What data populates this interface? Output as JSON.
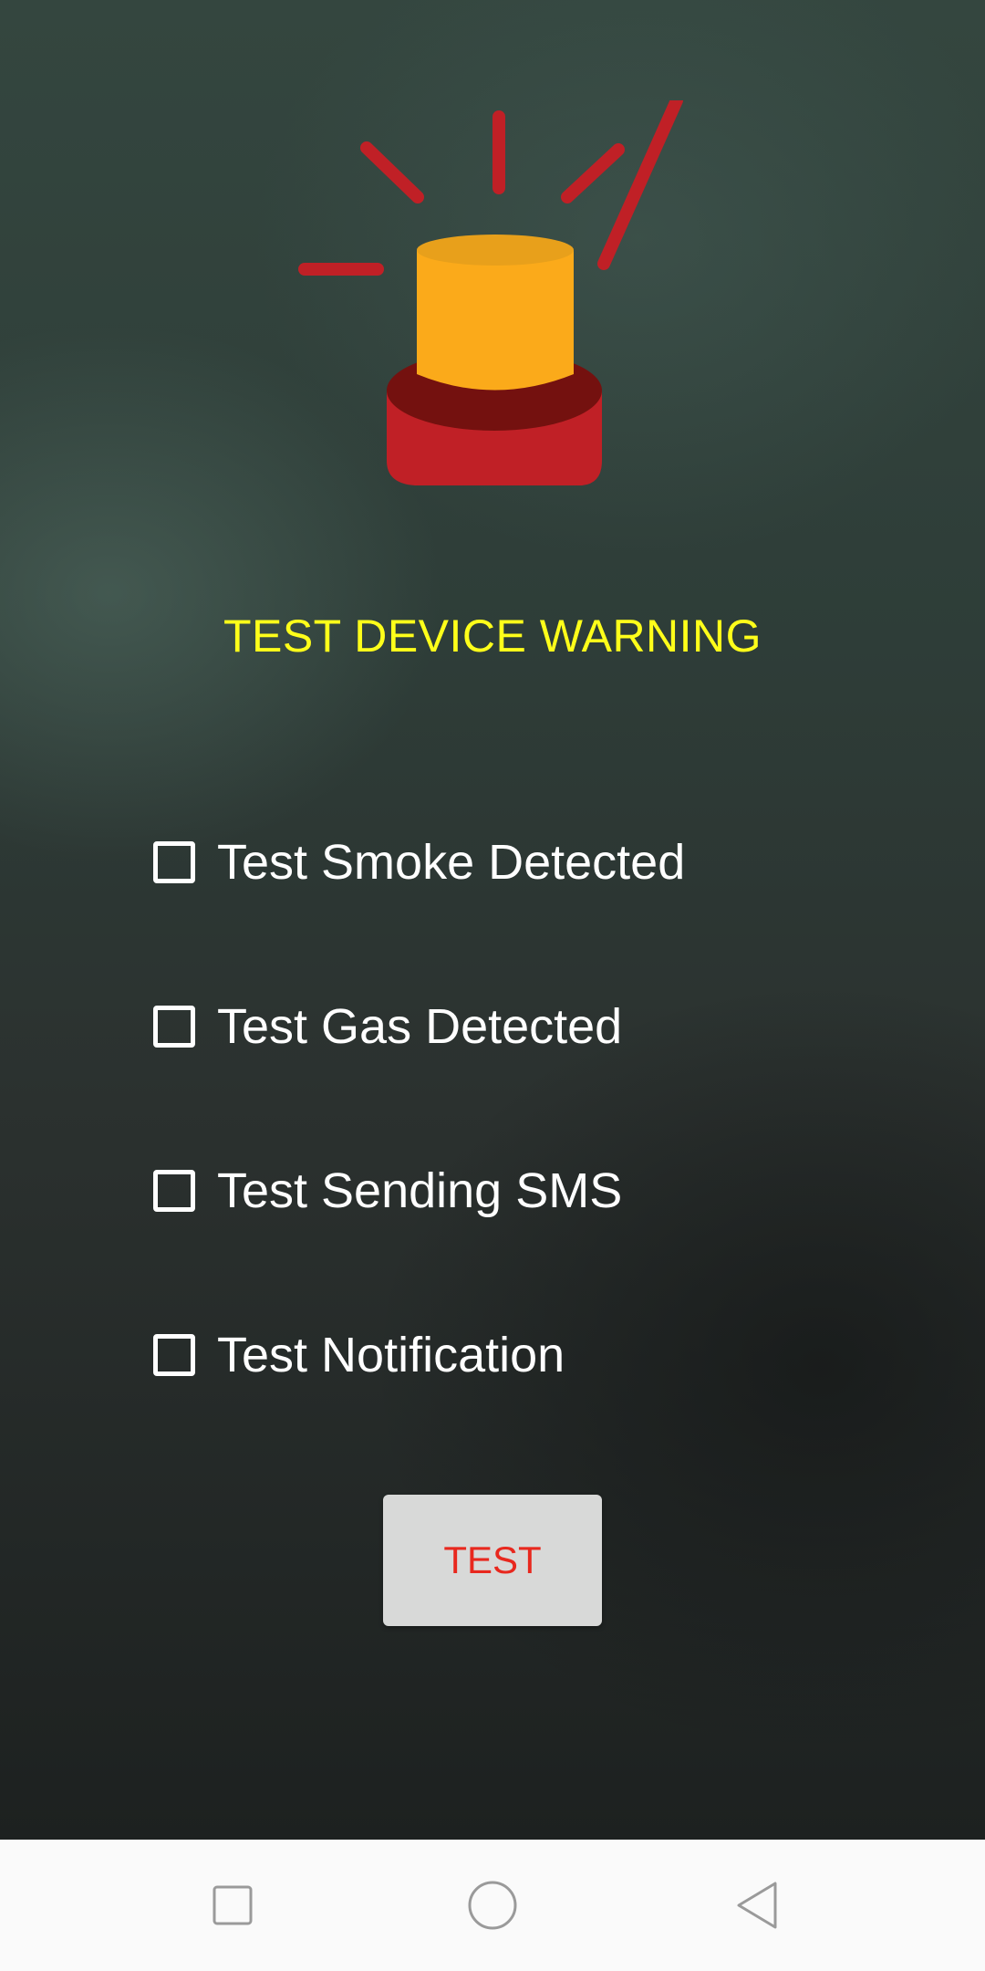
{
  "header": {
    "icon": "siren-icon",
    "title": "TEST DEVICE WARNING"
  },
  "options": [
    {
      "label": "Test Smoke Detected",
      "checked": false
    },
    {
      "label": "Test Gas Detected",
      "checked": false
    },
    {
      "label": "Test Sending SMS",
      "checked": false
    },
    {
      "label": "Test Notification",
      "checked": false
    }
  ],
  "test_button": {
    "label": "TEST"
  },
  "navbar": {
    "icons": [
      "recents-square-icon",
      "home-circle-icon",
      "back-triangle-icon"
    ]
  },
  "colors": {
    "title": "#ffff1a",
    "button_text": "#e8281e",
    "button_bg": "#d8d9d8",
    "siren_body": "#fbaa1a",
    "siren_base": "#c02026"
  }
}
